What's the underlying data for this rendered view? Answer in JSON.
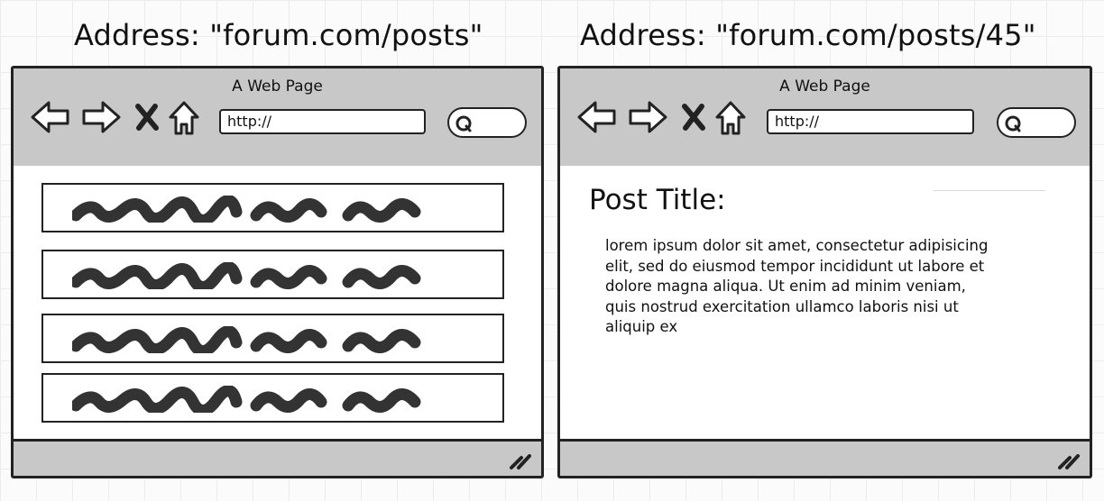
{
  "captions": {
    "left": "Address: \"forum.com/posts\"",
    "right": "Address: \"forum.com/posts/45\""
  },
  "browser_left": {
    "page_title": "A Web Page",
    "address_text": "http://",
    "list_items": [
      {
        "name": "post-entry-1"
      },
      {
        "name": "post-entry-2"
      },
      {
        "name": "post-entry-3"
      },
      {
        "name": "post-entry-4"
      }
    ]
  },
  "browser_right": {
    "page_title": "A Web Page",
    "address_text": "http://",
    "post_title": "Post Title:",
    "post_body": "lorem ipsum dolor sit amet, consectetur adipisicing elit, sed do eiusmod tempor incididunt ut labore et dolore magna aliqua. Ut enim ad minim veniam, quis nostrud exercitation ullamco laboris nisi ut aliquip ex"
  },
  "icons": [
    "back-arrow-icon",
    "forward-arrow-icon",
    "stop-x-icon",
    "home-icon",
    "search-magnifier-icon",
    "resize-grip-icon"
  ],
  "colors": {
    "chrome": "#c8c8c8",
    "stroke": "#222222",
    "page": "#ffffff"
  }
}
